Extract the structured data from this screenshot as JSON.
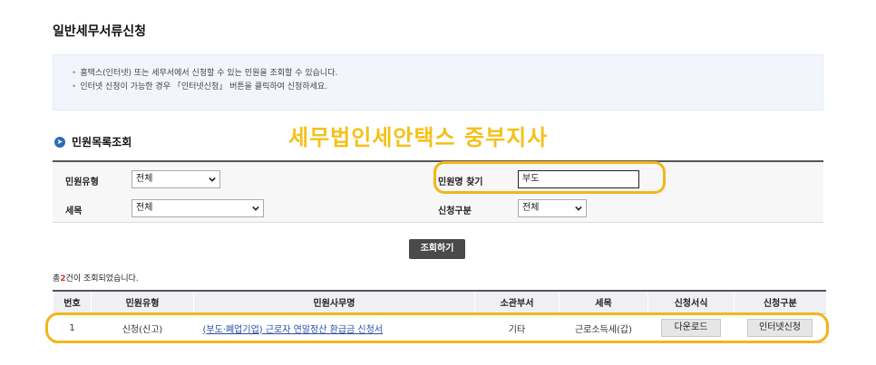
{
  "page": {
    "title": "일반세무서류신청"
  },
  "notice": {
    "bullet": "•",
    "lines": [
      "홈택스(인터넷) 또는 세무서에서 신청할 수 있는 민원을 조회할 수 있습니다.",
      "인터넷 신청이 가능한 경우 「인터넷신청」 버튼을 클릭하여 신청하세요."
    ]
  },
  "section": {
    "icon": "circle-arrow-right-icon",
    "title": "민원목록조회"
  },
  "watermark": "세무법인세안택스 중부지사",
  "search": {
    "petition_type": {
      "label": "민원유형",
      "value": "전체"
    },
    "tax_item": {
      "label": "세목",
      "value": "전체"
    },
    "petition_name": {
      "label": "민원명 찾기",
      "value": "부도"
    },
    "apply_type": {
      "label": "신청구분",
      "value": "전체"
    },
    "button": "조회하기"
  },
  "result": {
    "prefix": "총",
    "count": "2",
    "suffix": "건이 조회되었습니다."
  },
  "table": {
    "headers": [
      "번호",
      "민원유형",
      "민원사무명",
      "소관부서",
      "세목",
      "신청서식",
      "신청구분"
    ],
    "rows": [
      {
        "no": "1",
        "type": "신청(신고)",
        "name": "(부도·폐업기업) 근로자 연말정산 환급금 신청서",
        "dept": "기타",
        "tax": "근로소득세(갑)",
        "form_button": "다운로드",
        "apply_button": "인터넷신청"
      }
    ]
  },
  "colors": {
    "highlight": "#f3b51a",
    "watermark": "#f3c11a",
    "count": "#d23a2a",
    "link": "#2a4fa8"
  }
}
